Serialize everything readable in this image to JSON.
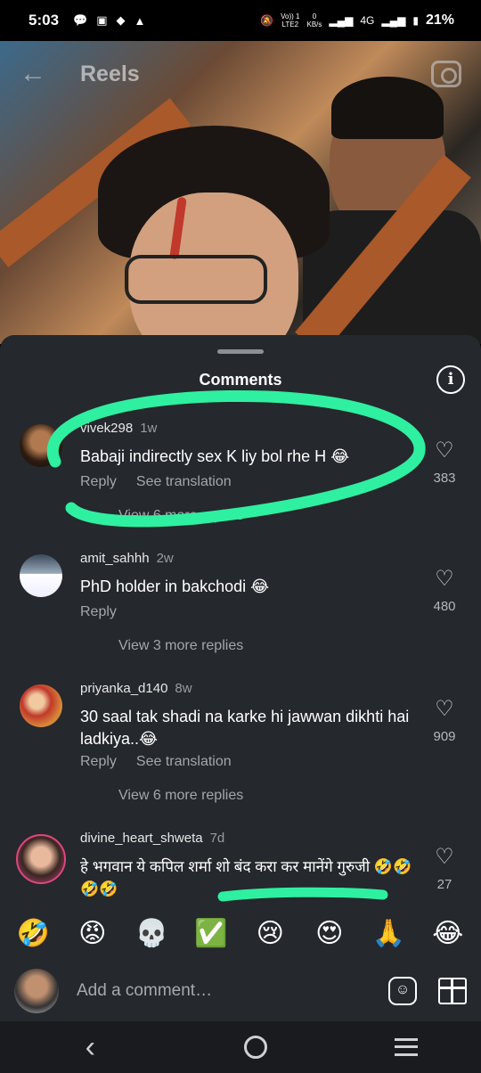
{
  "status": {
    "time": "5:03",
    "network": "4G",
    "battery": "21%",
    "volte_top": "Vo)) 1",
    "volte_bottom": "LTE2",
    "speed_top": "0",
    "speed_bottom": "KB/s"
  },
  "header": {
    "title": "Reels",
    "back_icon": "back-arrow-icon",
    "camera_icon": "camera-icon"
  },
  "sheet": {
    "title": "Comments",
    "info_icon": "info-icon"
  },
  "comments": [
    {
      "username": "vivek298",
      "time": "1w",
      "text": "Babaji indirectly sex K liy bol rhe H 😂",
      "reply": "Reply",
      "translate": "See translation",
      "likes": "383",
      "view_more": "View 6 more replies"
    },
    {
      "username": "amit_sahhh",
      "time": "2w",
      "text": "PhD holder in bakchodi 😂",
      "reply": "Reply",
      "likes": "480",
      "view_more": "View 3 more replies"
    },
    {
      "username": "priyanka_d140",
      "time": "8w",
      "text": "30 saal tak shadi na karke hi jawwan dikhti hai ladkiya..😂",
      "reply": "Reply",
      "translate": "See translation",
      "likes": "909",
      "view_more": "View 6 more replies"
    },
    {
      "username": "divine_heart_shweta",
      "time": "7d",
      "text": "हे भगवान ये कपिल शर्मा शो बंद करा कर मानेंगे गुरुजी 🤣🤣🤣🤣",
      "likes": "27"
    }
  ],
  "emoji_bar": [
    "🤣",
    "😡",
    "💀",
    "✅",
    "😢",
    "😍",
    "🙏",
    "😂"
  ],
  "composer": {
    "placeholder": "Add a comment…",
    "sticker_icon": "sticker-icon",
    "gift_icon": "gift-icon"
  },
  "colors": {
    "sheet_bg": "#25282d",
    "scribble": "#2ef0a0",
    "secondary_text": "#a4a6a9"
  }
}
